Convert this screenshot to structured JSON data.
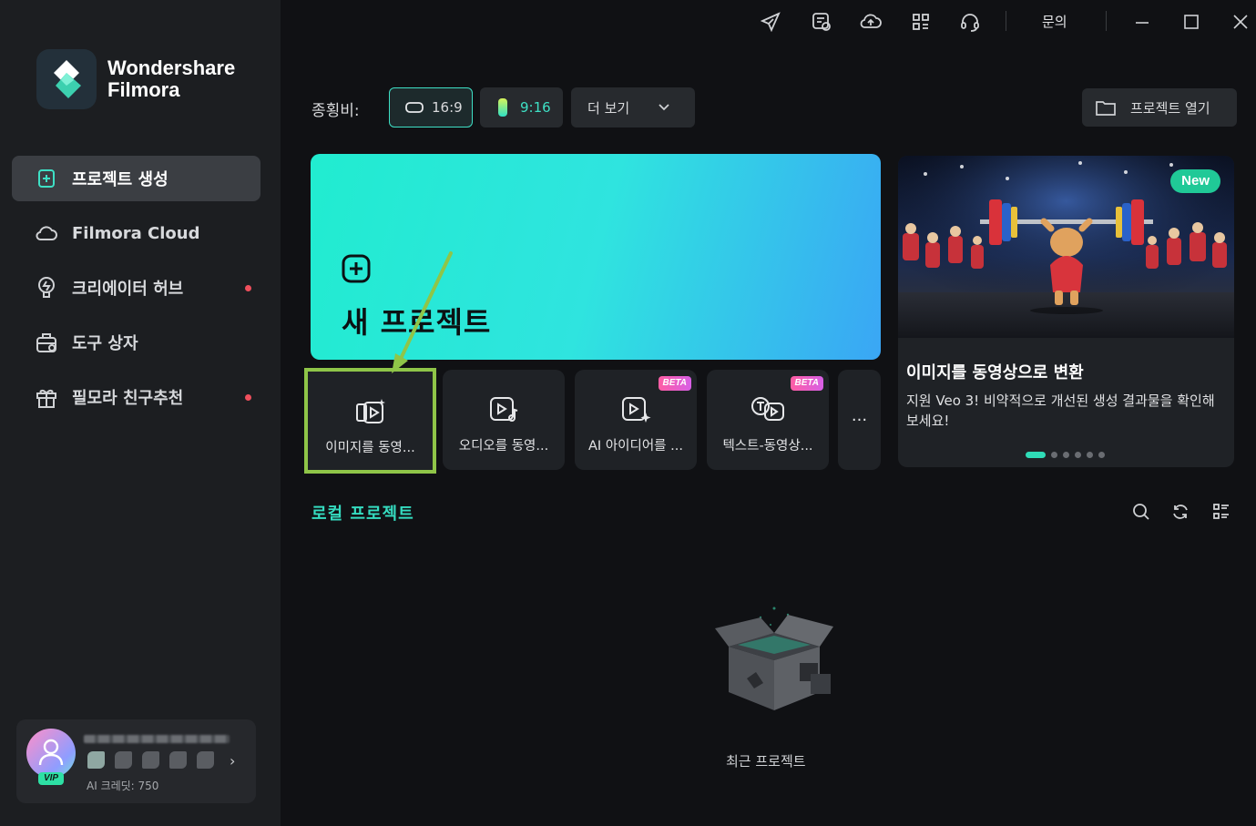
{
  "app": {
    "brand_line1": "Wondershare",
    "brand_line2": "Filmora"
  },
  "sidebar": {
    "items": [
      {
        "label": "프로젝트 생성",
        "icon": "add-project-icon",
        "active": true,
        "dot": false
      },
      {
        "label": "Filmora Cloud",
        "icon": "cloud-icon",
        "active": false,
        "dot": false
      },
      {
        "label": "크리에이터 허브",
        "icon": "bulb-icon",
        "active": false,
        "dot": true
      },
      {
        "label": "도구 상자",
        "icon": "toolbox-icon",
        "active": false,
        "dot": false
      },
      {
        "label": "필모라 친구추천",
        "icon": "gift-icon",
        "active": false,
        "dot": true
      }
    ]
  },
  "user": {
    "vip_label": "VIP",
    "credits": "AI 크레딧: 750"
  },
  "topbar": {
    "inquiry_label": "문의"
  },
  "aspect": {
    "label": "종횡비:",
    "ratio_16_9": "16:9",
    "ratio_9_16": "9:16",
    "more_label": "더 보기",
    "open_project_label": "프로젝트 열기"
  },
  "new_project": {
    "title": "새 프로젝트"
  },
  "tools": [
    {
      "label": "이미지를 동영...",
      "beta": false
    },
    {
      "label": "오디오를 동영...",
      "beta": false
    },
    {
      "label": "AI 아이디어를 ...",
      "beta": true
    },
    {
      "label": "텍스트-동영상...",
      "beta": true
    }
  ],
  "beta_label": "BETA",
  "more_tools_label": "···",
  "promo": {
    "badge": "New",
    "title": "이미지를 동영상으로 변환",
    "description": "지원 Veo 3!  비약적으로 개선된 생성 결과물을 확인해 보세요!",
    "slide_count": 6,
    "active_slide": 1
  },
  "local": {
    "title": "로컬 프로젝트",
    "empty_label": "최근 프로젝트"
  },
  "colors": {
    "accent": "#35dcc0",
    "highlight_box": "#8fc548",
    "notification_dot": "#ef4f5c"
  }
}
